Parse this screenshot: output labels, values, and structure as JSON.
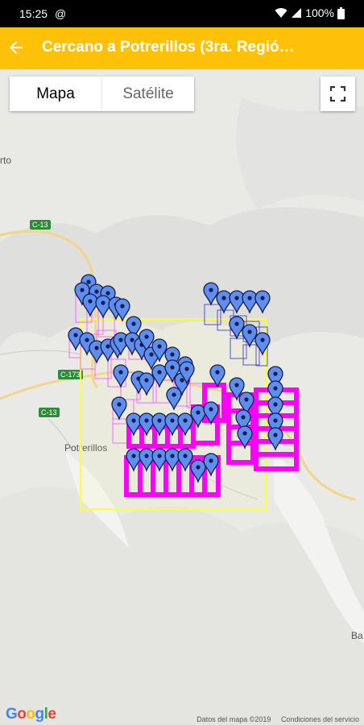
{
  "status_bar": {
    "time": "15:25",
    "notif_icons": "@",
    "battery": "100%"
  },
  "app_bar": {
    "title": "Cercano a Potrerillos (3ra. Regió…"
  },
  "map_type": {
    "map_label": "Mapa",
    "satellite_label": "Satélite",
    "selected": "Mapa"
  },
  "map_labels": {
    "road_c13_a": "C-13",
    "road_c173": "C-173",
    "road_c13_b": "C-13",
    "town": "Potrerillos",
    "edge_left": "rto",
    "edge_right": "Ba"
  },
  "footer": {
    "logo": "Google",
    "data_credit": "Datos del mapa ©2019",
    "terms": "Condiciones del servicio"
  },
  "colors": {
    "appbar": "#ffc107",
    "marker": "#5c8ff0",
    "rect_magenta": "#ff00ff",
    "rect_blue": "#5050d8",
    "rect_yellow": "#ffff33"
  }
}
